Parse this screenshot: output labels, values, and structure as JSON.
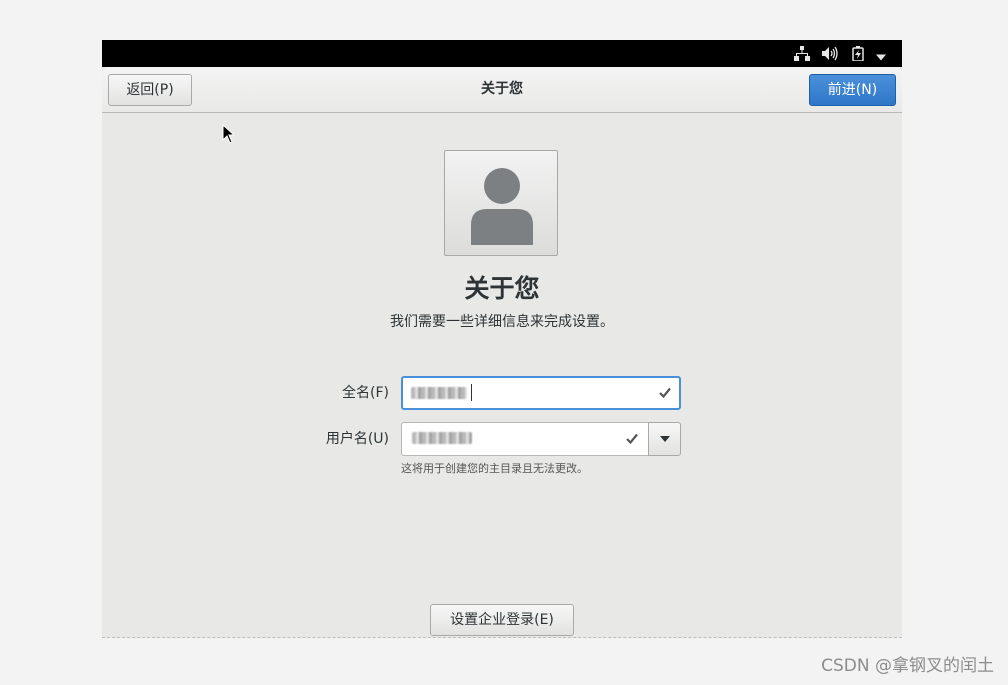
{
  "window": {
    "title": "关于您"
  },
  "header": {
    "back_label": "返回(P)",
    "next_label": "前进(N)"
  },
  "tray": {
    "icons": [
      "network-icon",
      "volume-icon",
      "battery-icon",
      "dropdown-arrow-icon"
    ]
  },
  "main": {
    "title": "关于您",
    "subtitle": "我们需要一些详细信息来完成设置。",
    "fullname": {
      "label": "全名(F)",
      "value": "",
      "valid": true
    },
    "username": {
      "label": "用户名(U)",
      "value": "",
      "valid": true,
      "hint": "这将用于创建您的主目录且无法更改。"
    },
    "enterprise_label": "设置企业登录(E)"
  },
  "watermark": "CSDN @拿钢叉的闰土",
  "colors": {
    "accent": "#4a90d9",
    "background": "#e8e8e7",
    "topbar": "#000000"
  }
}
